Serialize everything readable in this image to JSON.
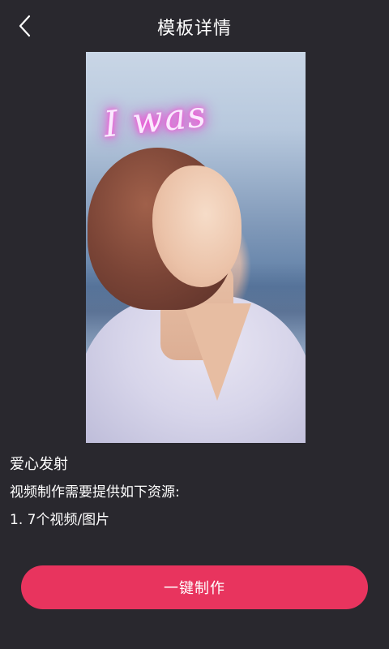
{
  "header": {
    "title": "模板详情",
    "back_icon": "chevron-left-icon"
  },
  "preview": {
    "overlay_text": "I was"
  },
  "info": {
    "template_name": "爱心发射",
    "requirement_label": "视频制作需要提供如下资源:",
    "requirement_item": "1. 7个视频/图片"
  },
  "action": {
    "make_label": "一键制作"
  },
  "colors": {
    "background": "#29282e",
    "accent": "#e8345e"
  }
}
